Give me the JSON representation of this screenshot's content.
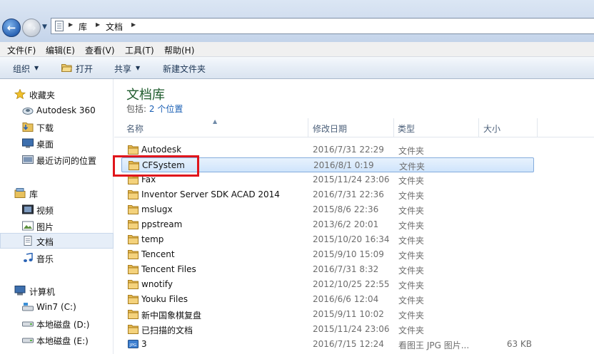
{
  "address": {
    "crumbs": [
      "库",
      "文档"
    ]
  },
  "menu": [
    "文件(F)",
    "编辑(E)",
    "查看(V)",
    "工具(T)",
    "帮助(H)"
  ],
  "toolbar": {
    "organize": "组织",
    "open": "打开",
    "share": "共享",
    "new_folder": "新建文件夹"
  },
  "nav": {
    "favorites": "收藏夹",
    "fav_items": [
      "Autodesk 360",
      "下载",
      "桌面",
      "最近访问的位置"
    ],
    "libraries": "库",
    "lib_items": [
      "视频",
      "图片",
      "文档",
      "音乐"
    ],
    "computer": "计算机",
    "drives": [
      "Win7 (C:)",
      "本地磁盘 (D:)",
      "本地磁盘 (E:)"
    ]
  },
  "library": {
    "title": "文档库",
    "includes_label": "包括:",
    "includes_link": "2 个位置"
  },
  "columns": {
    "name": "名称",
    "modified": "修改日期",
    "type": "类型",
    "size": "大小"
  },
  "files": [
    {
      "name": "Autodesk",
      "date": "2016/7/31 22:29",
      "type": "文件夹",
      "size": ""
    },
    {
      "name": "CFSystem",
      "date": "2016/8/1 0:19",
      "type": "文件夹",
      "size": ""
    },
    {
      "name": "Fax",
      "date": "2015/11/24 23:06",
      "type": "文件夹",
      "size": ""
    },
    {
      "name": "Inventor Server SDK ACAD 2014",
      "date": "2016/7/31 22:36",
      "type": "文件夹",
      "size": ""
    },
    {
      "name": "mslugx",
      "date": "2015/8/6 22:36",
      "type": "文件夹",
      "size": ""
    },
    {
      "name": "ppstream",
      "date": "2013/6/2 20:01",
      "type": "文件夹",
      "size": ""
    },
    {
      "name": "temp",
      "date": "2015/10/20 16:34",
      "type": "文件夹",
      "size": ""
    },
    {
      "name": "Tencent",
      "date": "2015/9/10 15:09",
      "type": "文件夹",
      "size": ""
    },
    {
      "name": "Tencent Files",
      "date": "2016/7/31 8:32",
      "type": "文件夹",
      "size": ""
    },
    {
      "name": "wnotify",
      "date": "2012/10/25 22:55",
      "type": "文件夹",
      "size": ""
    },
    {
      "name": "Youku Files",
      "date": "2016/6/6 12:04",
      "type": "文件夹",
      "size": ""
    },
    {
      "name": "新中国象棋复盘",
      "date": "2015/9/11 10:02",
      "type": "文件夹",
      "size": ""
    },
    {
      "name": "已扫描的文档",
      "date": "2015/11/24 23:06",
      "type": "文件夹",
      "size": ""
    },
    {
      "name": "3",
      "date": "2016/7/15 12:24",
      "type": "看图王 JPG 图片...",
      "size": "63 KB"
    }
  ],
  "colors": {
    "highlight": "#e0151b",
    "title_green": "#1e5b2c",
    "link_blue": "#1a5fb4",
    "selection": "#cfe4fb"
  }
}
